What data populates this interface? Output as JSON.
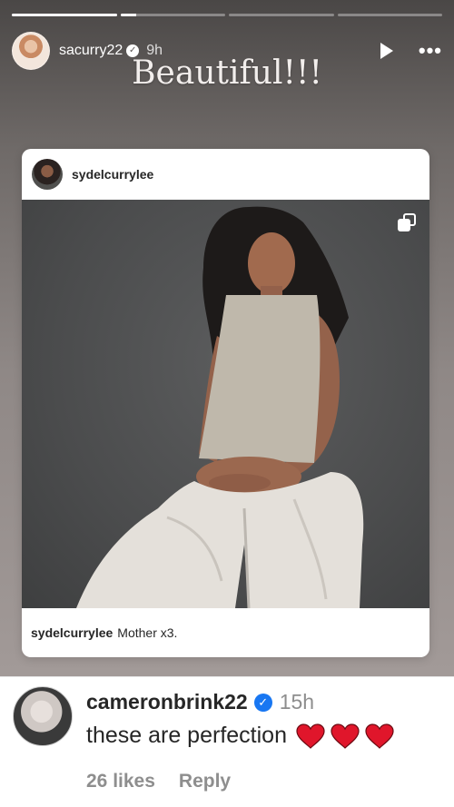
{
  "story": {
    "progress": [
      1.0,
      0.15,
      0.0,
      0.0
    ],
    "username": "sacurry22",
    "time": "9h",
    "overlay_text": "Beautiful!!!",
    "icons": {
      "verified": "verified-badge-icon",
      "play": "play-icon",
      "more": "more-options-icon"
    }
  },
  "post": {
    "username": "sydelcurrylee",
    "caption_user": "sydelcurrylee",
    "caption_text": "Mother x3.",
    "icons": {
      "carousel": "multiple-images-icon"
    }
  },
  "comment": {
    "username": "cameronbrink22",
    "time": "15h",
    "text": "these are perfection",
    "hearts": 3,
    "heart_color": "#e0162b",
    "verified_color": "#1877f2",
    "likes": "26 likes",
    "reply": "Reply"
  }
}
